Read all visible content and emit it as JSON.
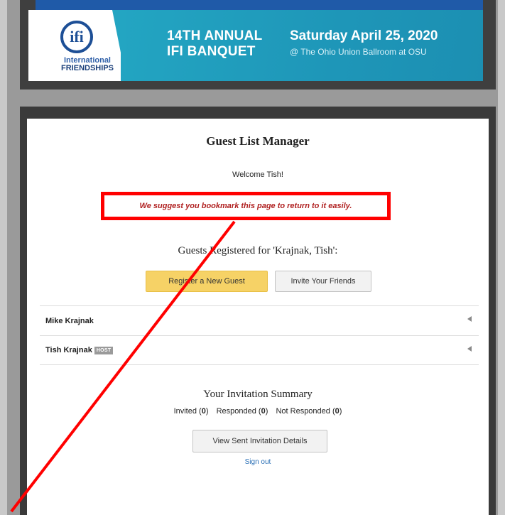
{
  "banner": {
    "logo_letters": "ifi",
    "logo_line1": "International",
    "logo_line2": "FRIENDSHIPS",
    "event_line1": "14TH ANNUAL",
    "event_line2": "IFI BANQUET",
    "date": "Saturday April 25, 2020",
    "venue": "@ The Ohio Union Ballroom at OSU"
  },
  "page": {
    "title": "Guest List Manager",
    "welcome": "Welcome Tish!",
    "bookmark_message": "We suggest you bookmark this page to return to it easily.",
    "guests_heading": "Guests Registered for 'Krajnak, Tish':"
  },
  "buttons": {
    "register": "Register a New Guest",
    "invite": "Invite Your Friends",
    "view_details": "View Sent Invitation Details"
  },
  "guests": [
    {
      "name": "Mike Krajnak",
      "badge": ""
    },
    {
      "name": "Tish Krajnak",
      "badge": "HOST"
    }
  ],
  "summary": {
    "heading": "Your Invitation Summary",
    "invited_label": "Invited",
    "invited_count": "0",
    "responded_label": "Responded",
    "responded_count": "0",
    "not_responded_label": "Not Responded",
    "not_responded_count": "0"
  },
  "sign_out": "Sign out",
  "colors": {
    "annotation_red": "#ff0000",
    "primary_button": "#f6d266",
    "banner_teal": "#23a5c2",
    "link_blue": "#2a6fb5"
  }
}
